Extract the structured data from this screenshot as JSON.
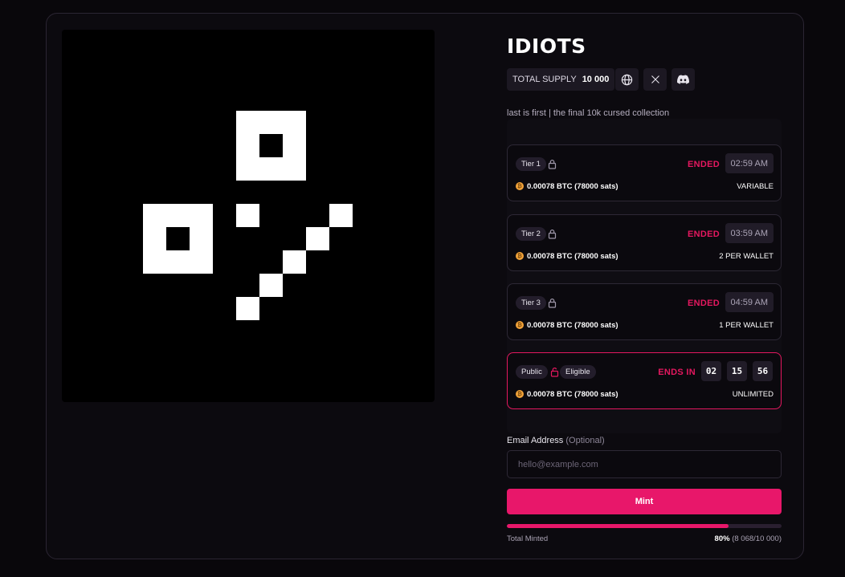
{
  "collection": {
    "title": "IDIOTS",
    "supply_label": "TOTAL SUPPLY",
    "supply_value": "10 000",
    "description": "last is first | the final 10k cursed collection"
  },
  "social": [
    {
      "icon": "globe-icon"
    },
    {
      "icon": "x-twitter-icon"
    },
    {
      "icon": "discord-icon"
    }
  ],
  "tiers": [
    {
      "name": "Tier 1",
      "status": "ENDED",
      "time": "02:59 AM",
      "price": "0.00078 BTC (78000 sats)",
      "limit": "VARIABLE"
    },
    {
      "name": "Tier 2",
      "status": "ENDED",
      "time": "03:59 AM",
      "price": "0.00078 BTC (78000 sats)",
      "limit": "2 PER WALLET"
    },
    {
      "name": "Tier 3",
      "status": "ENDED",
      "time": "04:59 AM",
      "price": "0.00078 BTC (78000 sats)",
      "limit": "1 PER WALLET"
    }
  ],
  "public": {
    "name": "Public",
    "eligibility": "Eligible",
    "status": "ENDS IN",
    "countdown": [
      "02",
      "15",
      "56"
    ],
    "price": "0.00078 BTC (78000 sats)",
    "limit": "UNLIMITED"
  },
  "email": {
    "label": "Email Address",
    "optional": "(Optional)",
    "placeholder": "hello@example.com"
  },
  "mint_button": "Mint",
  "progress": {
    "label": "Total Minted",
    "percent_text": "80%",
    "count_text": "(8 068/10 000)",
    "fraction": 0.8068
  },
  "colors": {
    "accent": "#e8176a",
    "background": "#09070b",
    "coin": "#f2a33a"
  }
}
